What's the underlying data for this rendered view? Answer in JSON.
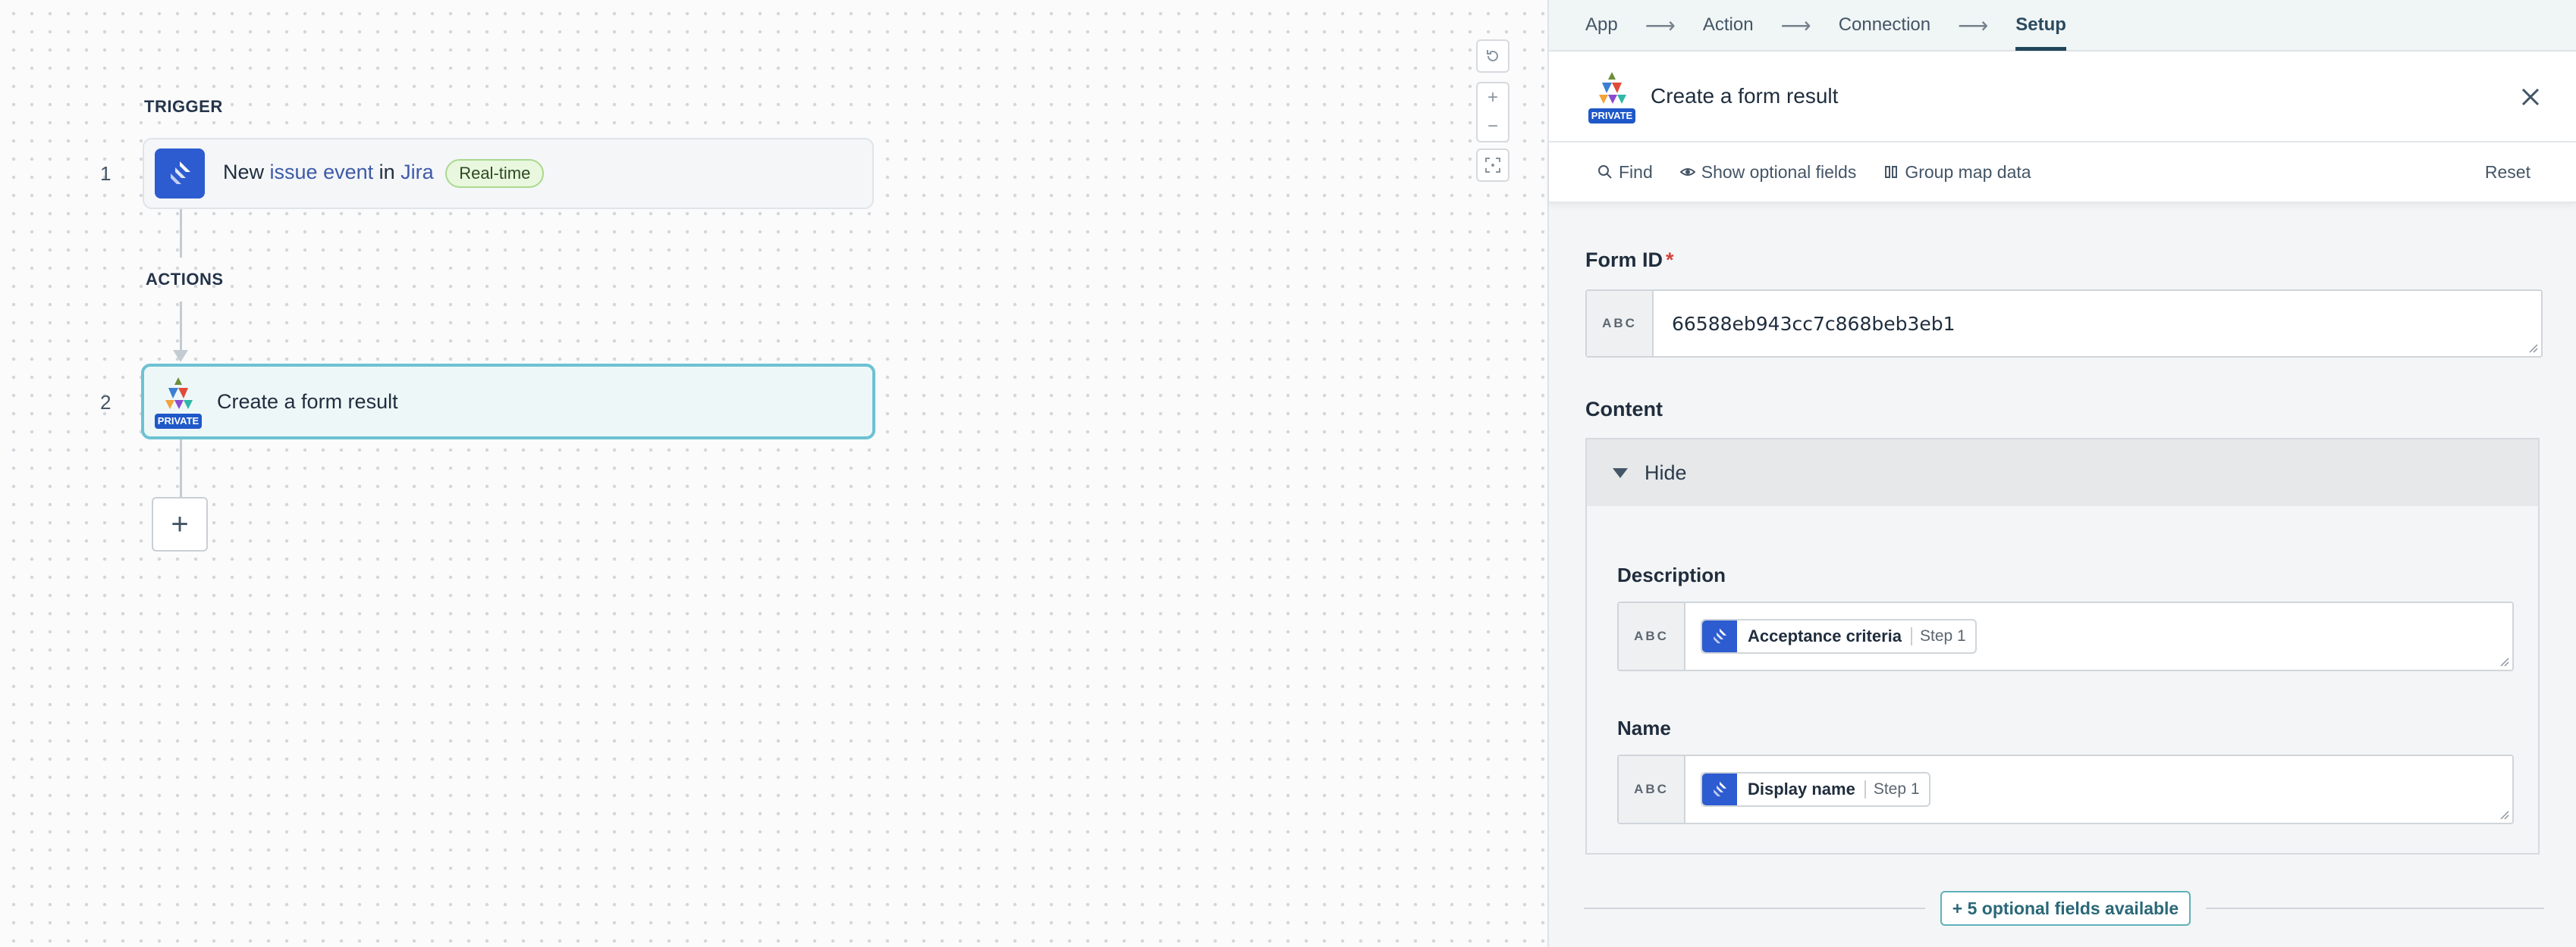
{
  "canvas": {
    "trigger_label": "TRIGGER",
    "actions_label": "ACTIONS",
    "step1": {
      "number": "1",
      "prefix": "New",
      "event": "issue event",
      "middle": "in",
      "app": "Jira",
      "badge": "Real-time",
      "icon": "jira-icon"
    },
    "step2": {
      "number": "2",
      "title": "Create a form result",
      "private_tag": "PRIVATE",
      "icon": "private-app-icon"
    },
    "add_step_symbol": "+",
    "zoom_controls": {
      "reset_icon": "rotate-ccw-icon",
      "zoom_in": "+",
      "zoom_out": "−",
      "fit_icon": "fit-view-icon"
    }
  },
  "panel": {
    "steps": [
      "App",
      "Action",
      "Connection",
      "Setup"
    ],
    "active_step": "Setup",
    "step_separator": "⟶",
    "header": {
      "title": "Create a form result",
      "private_tag": "PRIVATE",
      "close_icon": "close-icon"
    },
    "toolbar": {
      "find": "Find",
      "show_optional": "Show optional fields",
      "group_map": "Group map data",
      "reset": "Reset"
    },
    "form_id": {
      "label": "Form ID",
      "required_mark": "*",
      "type_tag": "ABC",
      "value": "66588eb943cc7c868beb3eb1"
    },
    "content": {
      "label": "Content",
      "toggle_label": "Hide",
      "description": {
        "label": "Description",
        "type_tag": "ABC",
        "pill_label": "Acceptance criteria",
        "pill_step": "Step 1"
      },
      "name": {
        "label": "Name",
        "type_tag": "ABC",
        "pill_label": "Display name",
        "pill_step": "Step 1"
      }
    },
    "optional_fields_button": "+ 5 optional fields available"
  },
  "colors": {
    "accent_teal": "#6cc2d3",
    "jira_blue": "#2d5bd0",
    "required_red": "#d6413a",
    "realtime_green_bg": "#e9f7de"
  }
}
